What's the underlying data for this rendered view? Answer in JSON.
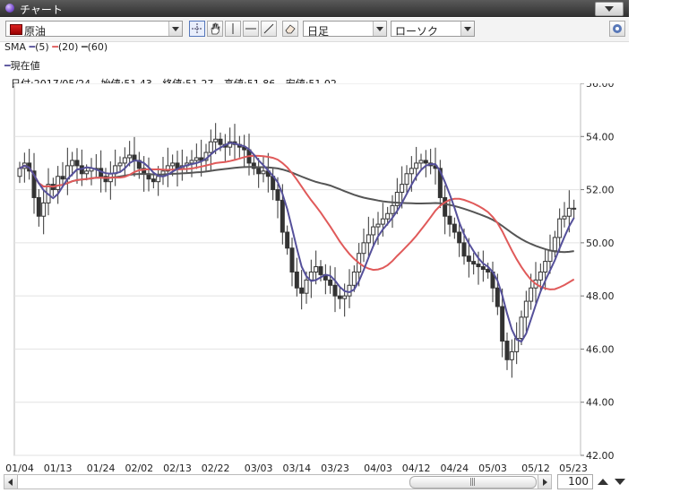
{
  "window": {
    "title": "チャート"
  },
  "toolbar": {
    "symbol": "原油",
    "period": "日足",
    "chart_type": "ローソク",
    "tools": [
      "crosshair-icon",
      "hand-icon",
      "vertical-line-icon",
      "horizontal-line-icon",
      "trendline-icon",
      "eraser-icon"
    ]
  },
  "legend": {
    "sma_label": "SMA",
    "sma_periods": [
      "(5)",
      "(20)",
      "(60)"
    ],
    "sma_colors": [
      "#55509a",
      "#e05a5a",
      "#555555"
    ],
    "current_price_label": "現在値"
  },
  "info": {
    "date": "日付:2017/05/24",
    "open": "始値:51.43",
    "close": "終値:51.27",
    "high": "高値:51.86",
    "low": "安値:51.02"
  },
  "footer": {
    "zoom_value": "100"
  },
  "chart_data": {
    "type": "candlestick",
    "x_tick_labels": [
      "01/04",
      "01/13",
      "01/24",
      "02/02",
      "02/13",
      "02/22",
      "03/03",
      "03/14",
      "03/23",
      "04/03",
      "04/12",
      "04/24",
      "05/03",
      "05/12",
      "05/23"
    ],
    "y_tick_labels": [
      "56.00",
      "54.00",
      "52.00",
      "50.00",
      "48.00",
      "46.00",
      "44.00",
      "42.00"
    ],
    "ylim": [
      42,
      56
    ],
    "grid": true,
    "close": [
      52.8,
      53.0,
      52.7,
      51.7,
      51.0,
      51.5,
      52.2,
      52.0,
      52.5,
      52.4,
      52.9,
      53.1,
      52.9,
      52.6,
      52.7,
      52.8,
      52.8,
      52.5,
      52.3,
      52.6,
      52.9,
      53.0,
      53.2,
      53.3,
      53.1,
      52.8,
      52.6,
      52.4,
      52.3,
      52.5,
      52.7,
      52.9,
      53.0,
      52.8,
      52.9,
      53.0,
      53.1,
      53.2,
      53.1,
      53.4,
      53.8,
      53.9,
      53.7,
      53.6,
      53.8,
      53.7,
      53.6,
      53.5,
      53.0,
      52.8,
      52.6,
      52.7,
      52.5,
      52.0,
      51.6,
      50.4,
      49.8,
      48.9,
      48.3,
      48.1,
      48.6,
      48.9,
      49.1,
      48.8,
      48.6,
      48.4,
      48.0,
      47.9,
      48.0,
      48.4,
      48.9,
      49.6,
      50.0,
      50.3,
      50.6,
      50.7,
      50.9,
      51.1,
      51.4,
      51.9,
      52.2,
      52.6,
      52.8,
      53.0,
      53.1,
      53.0,
      52.9,
      52.8,
      51.7,
      51.0,
      50.7,
      50.4,
      50.0,
      49.5,
      49.3,
      49.2,
      49.1,
      49.0,
      48.9,
      48.3,
      47.6,
      46.3,
      45.6,
      45.9,
      46.4,
      47.2,
      47.8,
      48.3,
      48.6,
      48.9,
      49.3,
      49.7,
      50.2,
      50.9,
      51.0,
      51.3,
      51.3
    ],
    "x_range_dates": [
      "2017/01/04",
      "2017/05/24"
    ],
    "sma5": "shown",
    "sma20": "shown",
    "sma60": "shown"
  }
}
